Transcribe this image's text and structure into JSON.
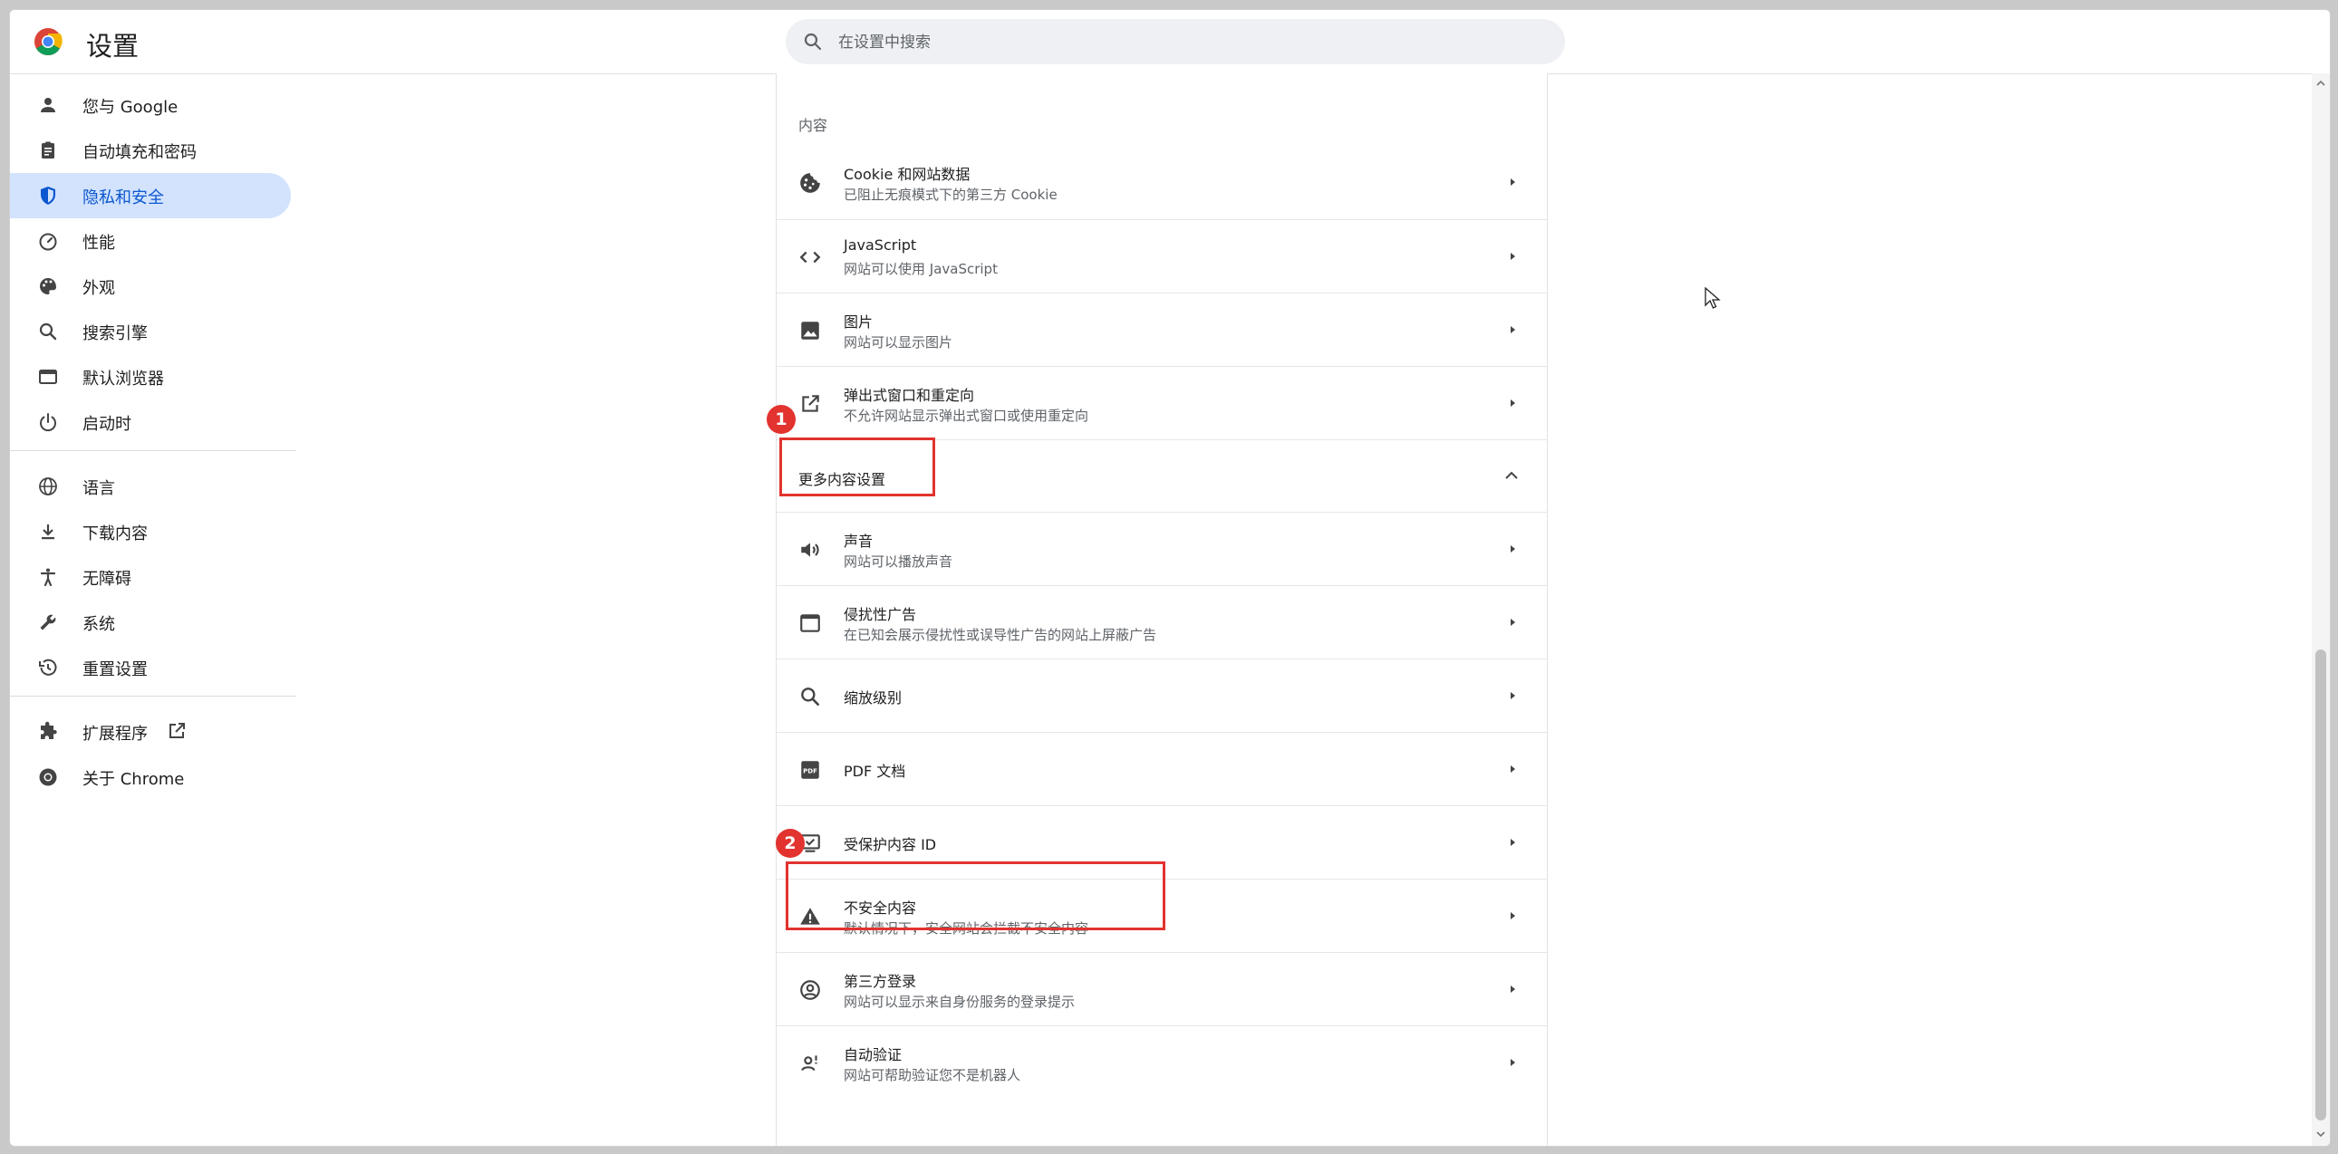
{
  "app": {
    "title": "设置"
  },
  "search": {
    "placeholder": "在设置中搜索"
  },
  "sidebar": {
    "items": [
      {
        "label": "您与 Google",
        "icon": "person-icon"
      },
      {
        "label": "自动填充和密码",
        "icon": "clipboard-icon"
      },
      {
        "label": "隐私和安全",
        "icon": "shield-icon",
        "active": true
      },
      {
        "label": "性能",
        "icon": "speedometer-icon"
      },
      {
        "label": "外观",
        "icon": "palette-icon"
      },
      {
        "label": "搜索引擎",
        "icon": "search-icon"
      },
      {
        "label": "默认浏览器",
        "icon": "browser-icon"
      },
      {
        "label": "启动时",
        "icon": "power-icon"
      }
    ],
    "items2": [
      {
        "label": "语言",
        "icon": "globe-icon"
      },
      {
        "label": "下载内容",
        "icon": "download-icon"
      },
      {
        "label": "无障碍",
        "icon": "accessibility-icon"
      },
      {
        "label": "系统",
        "icon": "wrench-icon"
      },
      {
        "label": "重置设置",
        "icon": "history-icon"
      }
    ],
    "items3": [
      {
        "label": "扩展程序",
        "icon": "puzzle-icon"
      },
      {
        "label": "关于 Chrome",
        "icon": "chrome-icon"
      }
    ]
  },
  "main": {
    "section_label": "内容",
    "rows": [
      {
        "title": "Cookie 和网站数据",
        "subtitle": "已阻止无痕模式下的第三方 Cookie",
        "icon": "cookie-icon"
      },
      {
        "title": "JavaScript",
        "subtitle": "网站可以使用 JavaScript",
        "icon": "code-icon"
      },
      {
        "title": "图片",
        "subtitle": "网站可以显示图片",
        "icon": "image-icon"
      },
      {
        "title": "弹出式窗口和重定向",
        "subtitle": "不允许网站显示弹出式窗口或使用重定向",
        "icon": "open-in-new-icon"
      }
    ],
    "more_label": "更多内容设置",
    "more_rows": [
      {
        "title": "声音",
        "subtitle": "网站可以播放声音",
        "icon": "volume-icon"
      },
      {
        "title": "侵扰性广告",
        "subtitle": "在已知会展示侵扰性或误导性广告的网站上屏蔽广告",
        "icon": "ads-icon"
      },
      {
        "title": "缩放级别",
        "subtitle": "",
        "icon": "zoom-icon"
      },
      {
        "title": "PDF 文档",
        "subtitle": "",
        "icon": "pdf-icon"
      },
      {
        "title": "受保护内容 ID",
        "subtitle": "",
        "icon": "protected-content-icon"
      },
      {
        "title": "不安全内容",
        "subtitle": "默认情况下，安全网站会拦截不安全内容",
        "icon": "warning-icon"
      },
      {
        "title": "第三方登录",
        "subtitle": "网站可以显示来自身份服务的登录提示",
        "icon": "account-circle-icon"
      },
      {
        "title": "自动验证",
        "subtitle": "网站可帮助验证您不是机器人",
        "icon": "auto-verify-icon"
      }
    ]
  },
  "annotations": [
    {
      "label": "1"
    },
    {
      "label": "2"
    }
  ],
  "colors": {
    "accent": "#0b57d0",
    "active_bg": "#d3e3fd",
    "annotation": "#e2332f"
  }
}
